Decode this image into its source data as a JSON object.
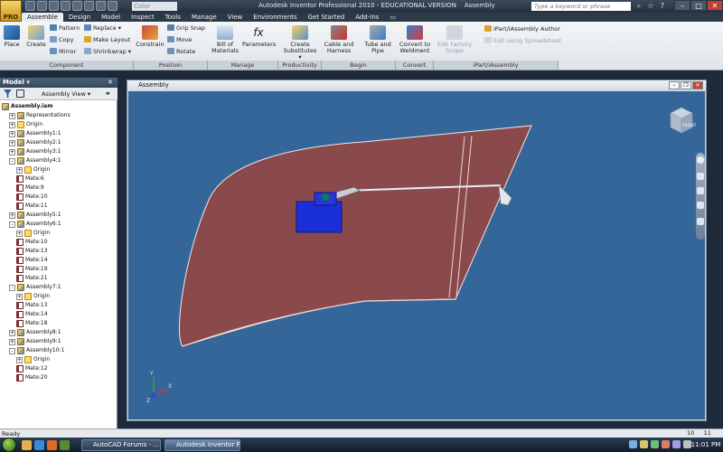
{
  "app": {
    "logo_text": "PRO",
    "window_title": "Autodesk Inventor Professional 2010 - EDUCATIONAL VERSION",
    "doc_name": "Assembly",
    "color_combo": "Color",
    "search_placeholder": "Type a keyword or phrase"
  },
  "tabs": [
    "Assemble",
    "Design",
    "Model",
    "Inspect",
    "Tools",
    "Manage",
    "View",
    "Environments",
    "Get Started",
    "Add-Ins"
  ],
  "active_tab": "Assemble",
  "ribbon": {
    "place": "Place",
    "create": "Create",
    "pattern": "Pattern",
    "copy": "Copy",
    "mirror": "Mirror",
    "replace": "Replace",
    "make_layout": "Make Layout",
    "shrinkwrap": "Shrinkwrap",
    "constrain": "Constrain",
    "grip_snap": "Grip Snap",
    "move": "Move",
    "rotate": "Rotate",
    "bom_l1": "Bill of",
    "bom_l2": "Materials",
    "parameters": "Parameters",
    "create_subs_l1": "Create",
    "create_subs_l2": "Substitutes",
    "cable_l1": "Cable and",
    "cable_l2": "Harness",
    "tube_l1": "Tube and",
    "tube_l2": "Pipe",
    "convert_l1": "Convert to",
    "convert_l2": "Weldment",
    "factory_l1": "Edit Factory",
    "factory_l2": "Scope",
    "ipart_author": "iPart/iAssembly Author",
    "edit_spreadsheet": "Edit using Spreadsheet"
  },
  "groups": [
    "Component",
    "Position",
    "Manage",
    "Productivity",
    "Begin",
    "Convert",
    "iPart/iAssembly"
  ],
  "browser": {
    "title": "Model",
    "view_mode": "Assembly View",
    "tree": [
      {
        "label": "Assembly.iam",
        "level": 0,
        "icon": "asm",
        "bold": true,
        "exp": ""
      },
      {
        "label": "Representations",
        "level": 1,
        "icon": "asm",
        "exp": "+"
      },
      {
        "label": "Origin",
        "level": 1,
        "icon": "folder",
        "exp": "+"
      },
      {
        "label": "Assembly1:1",
        "level": 1,
        "icon": "asm",
        "exp": "+"
      },
      {
        "label": "Assembly2:1",
        "level": 1,
        "icon": "asm",
        "exp": "+"
      },
      {
        "label": "Assembly3:1",
        "level": 1,
        "icon": "asm",
        "exp": "+"
      },
      {
        "label": "Assembly4:1",
        "level": 1,
        "icon": "asm",
        "exp": "-"
      },
      {
        "label": "Origin",
        "level": 2,
        "icon": "folder",
        "exp": "+"
      },
      {
        "label": "Mate:6",
        "level": 2,
        "icon": "mate",
        "exp": ""
      },
      {
        "label": "Mate:9",
        "level": 2,
        "icon": "mate",
        "exp": ""
      },
      {
        "label": "Mate:10",
        "level": 2,
        "icon": "mate",
        "exp": ""
      },
      {
        "label": "Mate:11",
        "level": 2,
        "icon": "mate",
        "exp": ""
      },
      {
        "label": "Assembly5:1",
        "level": 1,
        "icon": "asm",
        "exp": "+"
      },
      {
        "label": "Assembly6:1",
        "level": 1,
        "icon": "asm",
        "exp": "-"
      },
      {
        "label": "Origin",
        "level": 2,
        "icon": "folder",
        "exp": "+"
      },
      {
        "label": "Mate:10",
        "level": 2,
        "icon": "mate",
        "exp": ""
      },
      {
        "label": "Mate:13",
        "level": 2,
        "icon": "mate",
        "exp": ""
      },
      {
        "label": "Mate:14",
        "level": 2,
        "icon": "mate",
        "exp": ""
      },
      {
        "label": "Mate:19",
        "level": 2,
        "icon": "mate",
        "exp": ""
      },
      {
        "label": "Mate:21",
        "level": 2,
        "icon": "mate",
        "exp": ""
      },
      {
        "label": "Assembly7:1",
        "level": 1,
        "icon": "asm",
        "exp": "-"
      },
      {
        "label": "Origin",
        "level": 2,
        "icon": "folder",
        "exp": "+"
      },
      {
        "label": "Mate:13",
        "level": 2,
        "icon": "mate",
        "exp": ""
      },
      {
        "label": "Mate:14",
        "level": 2,
        "icon": "mate",
        "exp": ""
      },
      {
        "label": "Mate:18",
        "level": 2,
        "icon": "mate",
        "exp": ""
      },
      {
        "label": "Assembly8:1",
        "level": 1,
        "icon": "asm",
        "exp": "+"
      },
      {
        "label": "Assembly9:1",
        "level": 1,
        "icon": "asm",
        "exp": "+"
      },
      {
        "label": "Assembly10:1",
        "level": 1,
        "icon": "asm",
        "exp": "-"
      },
      {
        "label": "Origin",
        "level": 2,
        "icon": "folder",
        "exp": "+"
      },
      {
        "label": "Mate:12",
        "level": 2,
        "icon": "mate",
        "exp": ""
      },
      {
        "label": "Mate:20",
        "level": 2,
        "icon": "mate",
        "exp": ""
      }
    ]
  },
  "viewcube_label": "FRONT",
  "triad": {
    "x": "X",
    "y": "Y",
    "z": "Z"
  },
  "status": {
    "text": "Ready",
    "num1": "10",
    "num2": "11"
  },
  "taskbar": {
    "tasks": [
      "AutoCAD Forums - ...",
      "Autodesk Inventor P..."
    ],
    "clock": "11:01 PM"
  },
  "colors": {
    "viewport": "#35669a",
    "wing": "#8a4a4c",
    "servo": "#1a2fd6",
    "accent": "#d9a52a"
  }
}
